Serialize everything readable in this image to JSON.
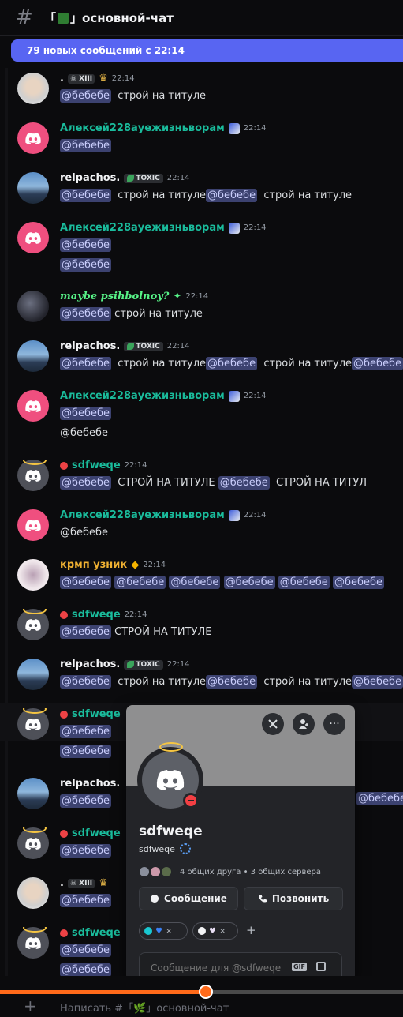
{
  "header": {
    "hash": "#",
    "channel_prefix": "「",
    "channel_suffix": "」основной-чат"
  },
  "banner": {
    "text": "79 новых сообщений с 22:14"
  },
  "messages": [
    {
      "author": ".",
      "badge": "XIII",
      "time": "22:14",
      "lines": [
        [
          {
            "m": "@бебебе"
          },
          {
            "t": "  строй на титуле"
          }
        ]
      ]
    },
    {
      "author": "Алексей228ауежизньворам",
      "time": "22:14",
      "lines": [
        [
          {
            "m": "@бебебе"
          }
        ]
      ]
    },
    {
      "author": "relpachos.",
      "badge": "TOXIC",
      "time": "22:14",
      "lines": [
        [
          {
            "m": "@бебебе"
          },
          {
            "t": "  строй на титуле"
          },
          {
            "m": "@бебебе"
          },
          {
            "t": "  строй на титуле"
          }
        ]
      ]
    },
    {
      "author": "Алексей228ауежизньворам",
      "time": "22:14",
      "lines": [
        [
          {
            "m": "@бебебе"
          }
        ],
        [
          {
            "m": "@бебебе"
          }
        ]
      ]
    },
    {
      "author": "maybe psihbolnoy?",
      "time": "22:14",
      "lines": [
        [
          {
            "m": "@бебебе"
          },
          {
            "t": " строй на титуле"
          }
        ]
      ]
    },
    {
      "author": "relpachos.",
      "badge": "TOXIC",
      "time": "22:14",
      "lines": [
        [
          {
            "m": "@бебебе"
          },
          {
            "t": "  строй на титуле"
          },
          {
            "m": "@бебебе"
          },
          {
            "t": "  строй на титуле"
          },
          {
            "m": "@бебебе"
          }
        ]
      ]
    },
    {
      "author": "Алексей228ауежизньворам",
      "time": "22:14",
      "lines": [
        [
          {
            "m": "@бебебе"
          }
        ],
        [
          {
            "t": "@бебебе"
          }
        ]
      ]
    },
    {
      "author": "sdfweqe",
      "time": "22:14",
      "lines": [
        [
          {
            "m": "@бебебе"
          },
          {
            "t": "  СТРОЙ НА ТИТУЛЕ "
          },
          {
            "m": "@бебебе"
          },
          {
            "t": "  СТРОЙ НА ТИТУЛ"
          }
        ]
      ]
    },
    {
      "author": "Алексей228ауежизньворам",
      "time": "22:14",
      "lines": [
        [
          {
            "t": "@бебебе"
          }
        ]
      ]
    },
    {
      "author": "крмп узник",
      "time": "22:14",
      "lines": [
        [
          {
            "m": "@бебебе"
          },
          {
            "t": " "
          },
          {
            "m": "@бебебе"
          },
          {
            "t": " "
          },
          {
            "m": "@бебебе"
          },
          {
            "t": " "
          },
          {
            "m": "@бебебе"
          },
          {
            "t": " "
          },
          {
            "m": "@бебебе"
          },
          {
            "t": " "
          },
          {
            "m": "@бебебе"
          }
        ]
      ]
    },
    {
      "author": "sdfweqe",
      "time": "22:14",
      "lines": [
        [
          {
            "m": "@бебебе"
          },
          {
            "t": " СТРОЙ НА ТИТУЛЕ"
          }
        ]
      ]
    },
    {
      "author": "relpachos.",
      "badge": "TOXIC",
      "time": "22:14",
      "lines": [
        [
          {
            "m": "@бебебе"
          },
          {
            "t": "  строй на титуле"
          },
          {
            "m": "@бебебе"
          },
          {
            "t": "  строй на титуле"
          },
          {
            "m": "@бебебе"
          }
        ]
      ]
    },
    {
      "author": "sdfweqe",
      "time": "",
      "lines": [
        [
          {
            "m": "@бебебе"
          }
        ],
        [
          {
            "m": "@бебебе"
          }
        ]
      ]
    },
    {
      "author": "relpachos.",
      "badge": "",
      "time": "",
      "lines": [
        [
          {
            "m": "@бебебе"
          }
        ]
      ]
    },
    {
      "author": "sdfweqe",
      "time": "",
      "lines": [
        [
          {
            "m": "@бебебе"
          }
        ]
      ]
    },
    {
      "author": ".",
      "badge": "XIII",
      "time": "",
      "lines": [
        [
          {
            "m": "@бебебе"
          }
        ]
      ]
    },
    {
      "author": "sdfweqe",
      "time": "",
      "lines": [
        [
          {
            "m": "@бебебе"
          }
        ],
        [
          {
            "m": "@бебебе"
          }
        ]
      ]
    }
  ],
  "right_tail_mention": "@бебебе",
  "popup": {
    "name": "sdfweqe",
    "username": "sdfweqe",
    "mutual": "4 общих друга • 3 общих сервера",
    "message_button": "Сообщение",
    "call_button": "Позвонить",
    "input_placeholder": "Сообщение для @sdfweqe",
    "gif_label": "GIF",
    "add_label": "+",
    "more_label": "···"
  },
  "composer": {
    "plus": "+",
    "placeholder": "Написать #「🌿」основной-чат"
  },
  "video": {
    "progress": 0.51
  },
  "colors": {
    "accent": "#5865f2",
    "mention_bg": "#3c4270",
    "progress": "#ff6a1a",
    "dnd": "#f23f43"
  }
}
